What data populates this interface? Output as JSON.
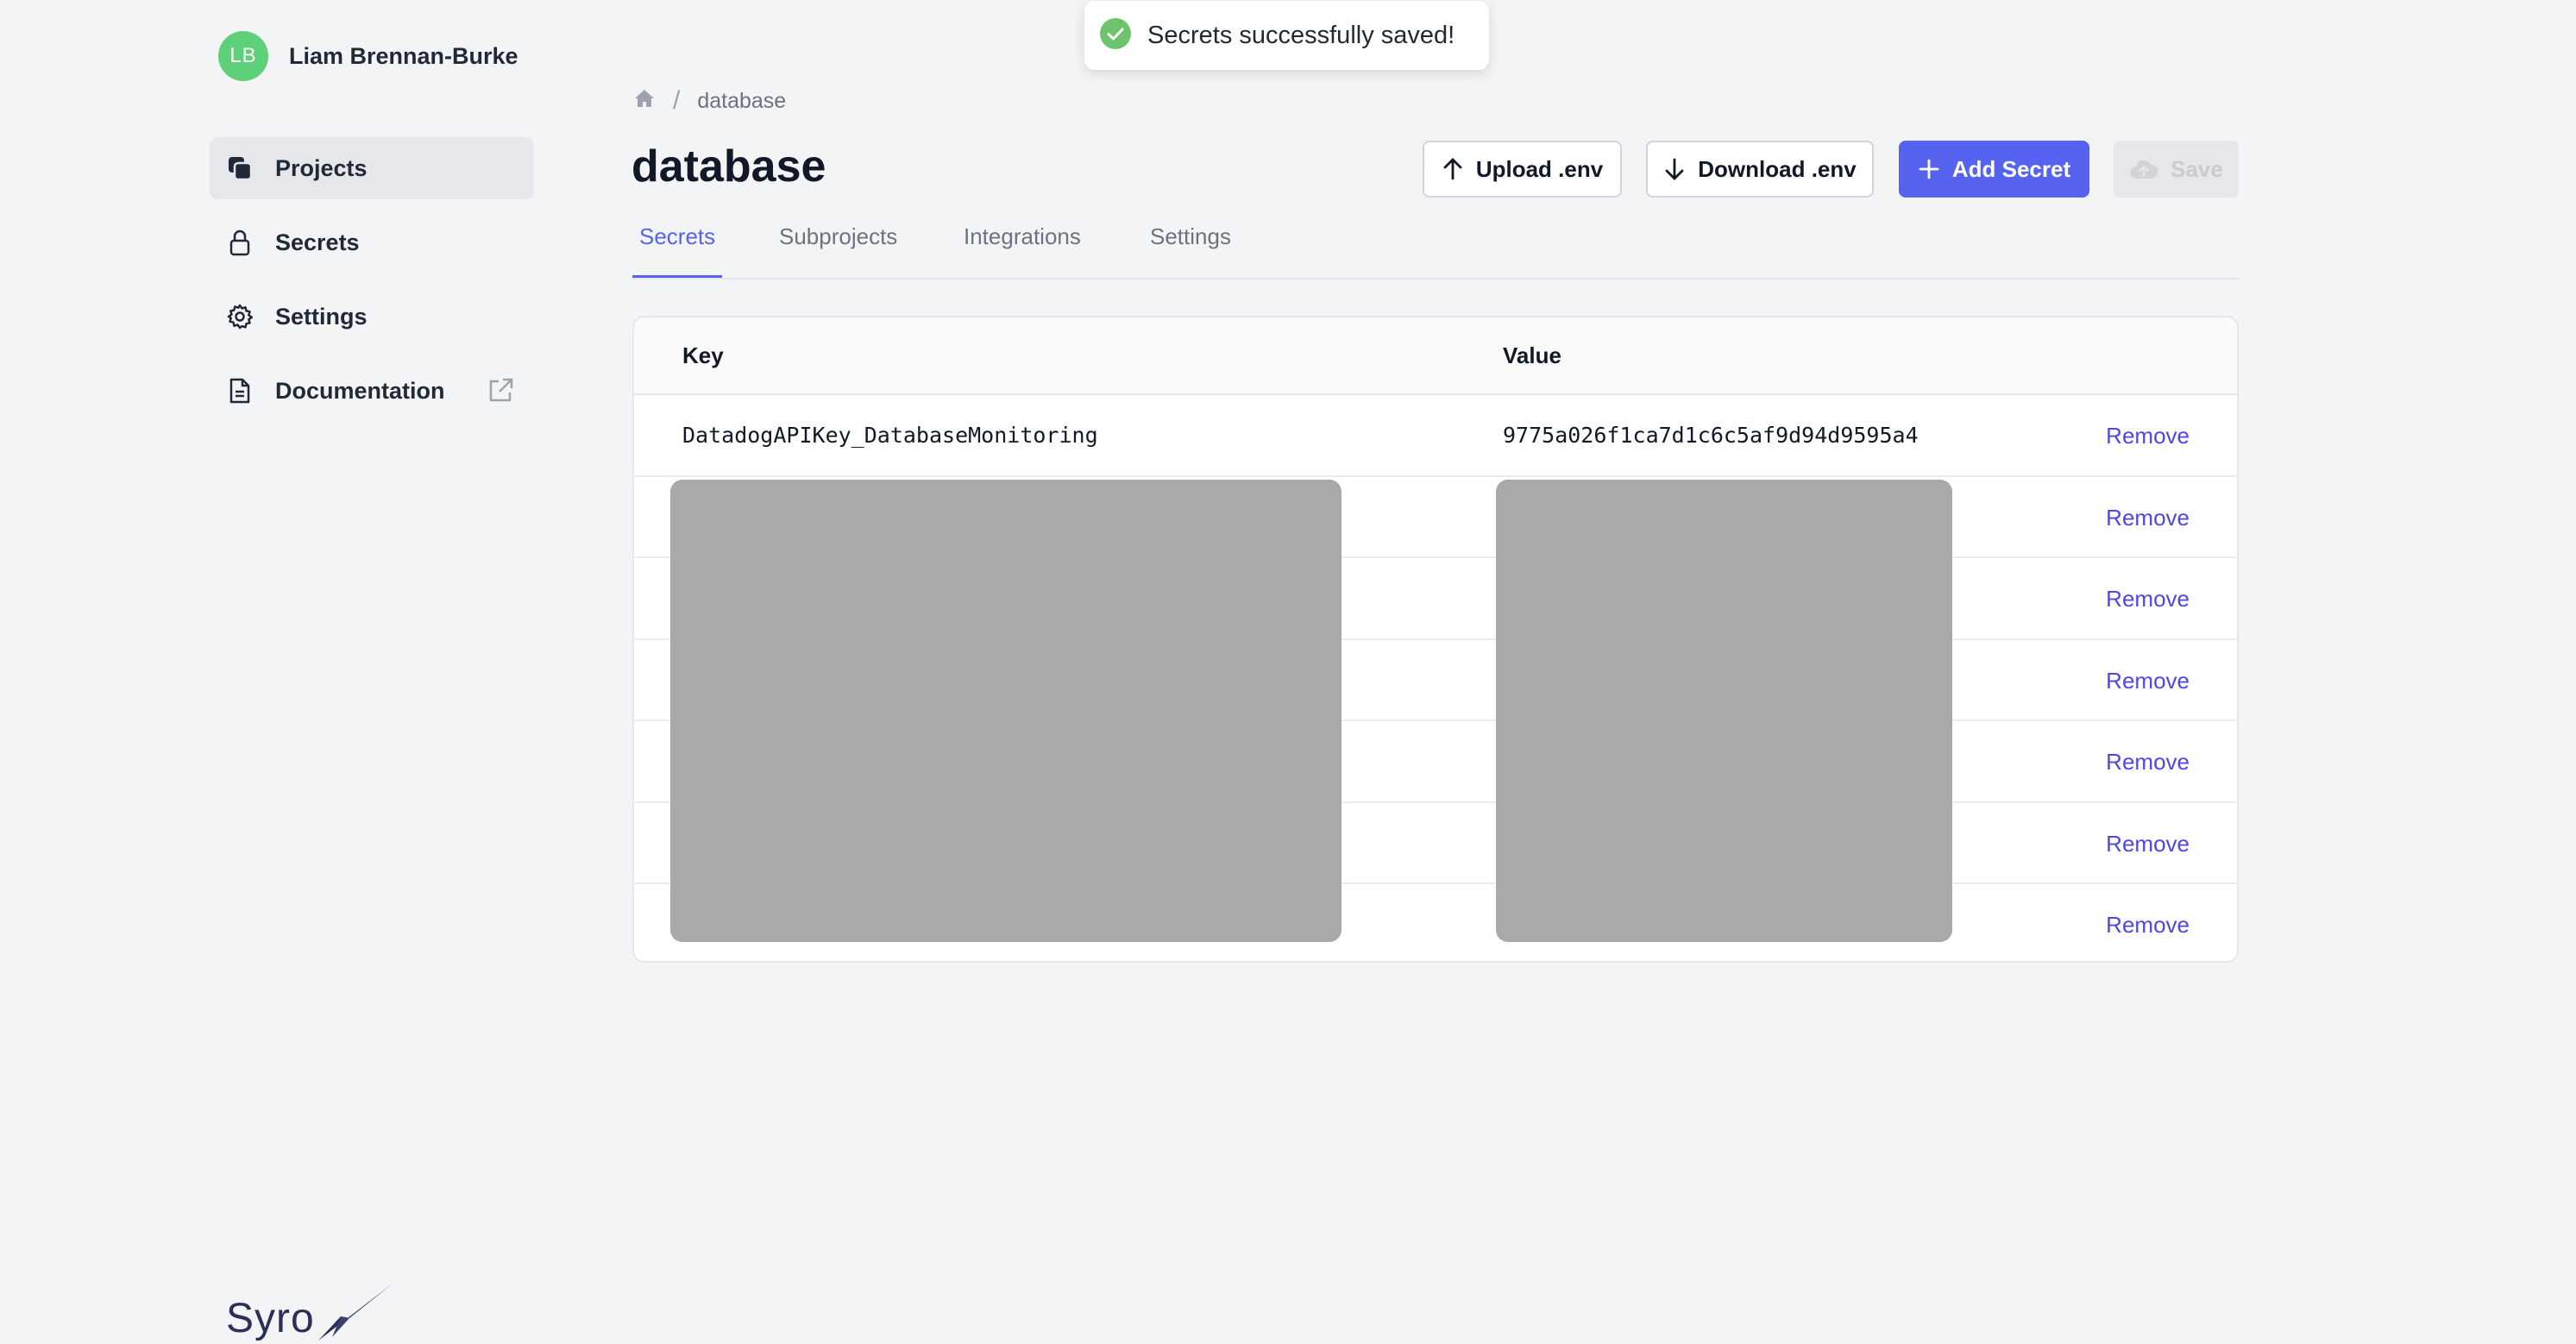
{
  "user": {
    "initials": "LB",
    "name": "Liam Brennan-Burke"
  },
  "sidebar": {
    "items": [
      {
        "label": "Projects",
        "icon": "projects-icon",
        "active": true
      },
      {
        "label": "Secrets",
        "icon": "lock-icon"
      },
      {
        "label": "Settings",
        "icon": "gear-icon"
      },
      {
        "label": "Documentation",
        "icon": "document-icon",
        "external": true
      }
    ]
  },
  "brand": {
    "name": "Syro"
  },
  "toast": {
    "message": "Secrets successfully saved!",
    "icon": "check-circle-icon"
  },
  "breadcrumb": {
    "home_icon": "home-icon",
    "current": "database"
  },
  "page": {
    "title": "database"
  },
  "toolbar": {
    "upload_label": "Upload .env",
    "download_label": "Download .env",
    "add_label": "Add Secret",
    "save_label": "Save"
  },
  "tabs": [
    "Secrets",
    "Subprojects",
    "Integrations",
    "Settings"
  ],
  "table": {
    "headers": {
      "key": "Key",
      "value": "Value"
    },
    "remove_label": "Remove",
    "rows": [
      {
        "key": "DatadogAPIKey_DatabaseMonitoring",
        "value": "9775a026f1ca7d1c6c5af9d94d9595a4"
      },
      {
        "key": "",
        "value": ""
      },
      {
        "key": "",
        "value": ""
      },
      {
        "key": "",
        "value": ""
      },
      {
        "key": "",
        "value": ""
      },
      {
        "key": "",
        "value": ""
      },
      {
        "key": "",
        "value": ""
      }
    ]
  },
  "colors": {
    "accent": "#5563f0",
    "link": "#4f46e5",
    "avatar": "#5fd07a",
    "success": "#6dc46b",
    "redacted": "#a9a9a9"
  }
}
